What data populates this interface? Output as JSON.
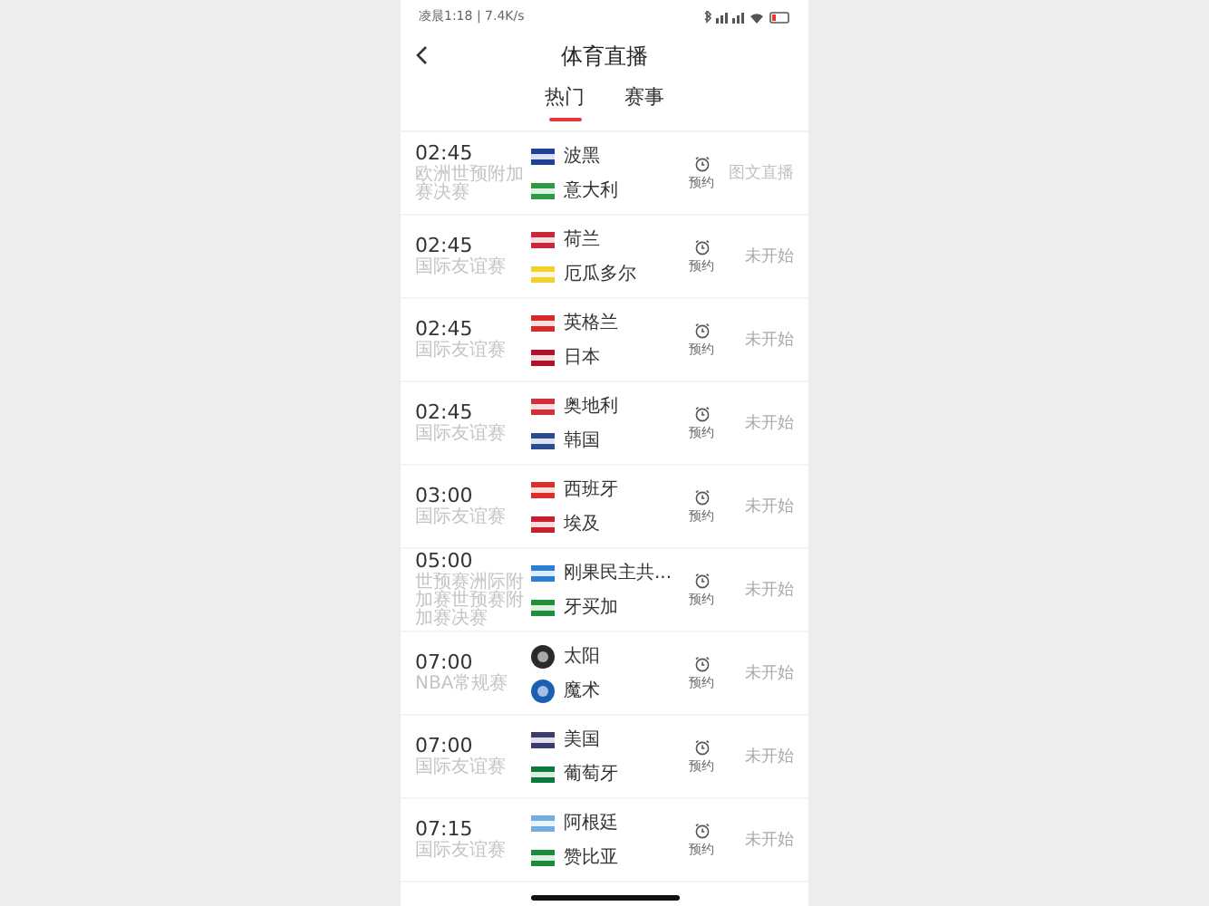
{
  "status_bar": {
    "text": "凌晨1:18 | 7.4K/s"
  },
  "header": {
    "title": "体育直播"
  },
  "tabs": [
    {
      "label": "热门",
      "selected": true
    },
    {
      "label": "赛事",
      "selected": false
    }
  ],
  "matches": [
    {
      "time": "02:45",
      "league": "欧洲世预附加赛决赛",
      "teams": [
        {
          "name": "波黑",
          "kind": "flag",
          "color": "#1f3f99"
        },
        {
          "name": "意大利",
          "kind": "flag",
          "color": "#2e9a47"
        }
      ],
      "reserve": "预约",
      "status": "图文直播",
      "live": true
    },
    {
      "time": "02:45",
      "league": "国际友谊赛",
      "teams": [
        {
          "name": "荷兰",
          "kind": "flag",
          "color": "#c8283a"
        },
        {
          "name": "厄瓜多尔",
          "kind": "flag",
          "color": "#f2cf2a"
        }
      ],
      "reserve": "预约",
      "status": "未开始",
      "live": false
    },
    {
      "time": "02:45",
      "league": "国际友谊赛",
      "teams": [
        {
          "name": "英格兰",
          "kind": "flag",
          "color": "#d42a2a"
        },
        {
          "name": "日本",
          "kind": "flag",
          "color": "#b0122c"
        }
      ],
      "reserve": "预约",
      "status": "未开始",
      "live": false
    },
    {
      "time": "02:45",
      "league": "国际友谊赛",
      "teams": [
        {
          "name": "奥地利",
          "kind": "flag",
          "color": "#d0303c"
        },
        {
          "name": "韩国",
          "kind": "flag",
          "color": "#2b4a8f"
        }
      ],
      "reserve": "预约",
      "status": "未开始",
      "live": false
    },
    {
      "time": "03:00",
      "league": "国际友谊赛",
      "teams": [
        {
          "name": "西班牙",
          "kind": "flag",
          "color": "#d8302b"
        },
        {
          "name": "埃及",
          "kind": "flag",
          "color": "#c8202e"
        }
      ],
      "reserve": "预约",
      "status": "未开始",
      "live": false
    },
    {
      "time": "05:00",
      "league": "世预赛洲际附加赛世预赛附加赛决赛",
      "teams": [
        {
          "name": "刚果民主共...",
          "kind": "flag",
          "color": "#2a7fd4"
        },
        {
          "name": "牙买加",
          "kind": "flag",
          "color": "#1f8f3a"
        }
      ],
      "reserve": "预约",
      "status": "未开始",
      "live": false
    },
    {
      "time": "07:00",
      "league": "NBA常规赛",
      "teams": [
        {
          "name": "太阳",
          "kind": "logo",
          "color": "#2a2a2a"
        },
        {
          "name": "魔术",
          "kind": "logo",
          "color": "#1a5fb4"
        }
      ],
      "reserve": "预约",
      "status": "未开始",
      "live": false
    },
    {
      "time": "07:00",
      "league": "国际友谊赛",
      "teams": [
        {
          "name": "美国",
          "kind": "flag",
          "color": "#3c3b6e"
        },
        {
          "name": "葡萄牙",
          "kind": "flag",
          "color": "#0a7a3a"
        }
      ],
      "reserve": "预约",
      "status": "未开始",
      "live": false
    },
    {
      "time": "07:15",
      "league": "国际友谊赛",
      "teams": [
        {
          "name": "阿根廷",
          "kind": "flag",
          "color": "#74acdf"
        },
        {
          "name": "赞比亚",
          "kind": "flag",
          "color": "#198a3a"
        }
      ],
      "reserve": "预约",
      "status": "未开始",
      "live": false
    }
  ]
}
